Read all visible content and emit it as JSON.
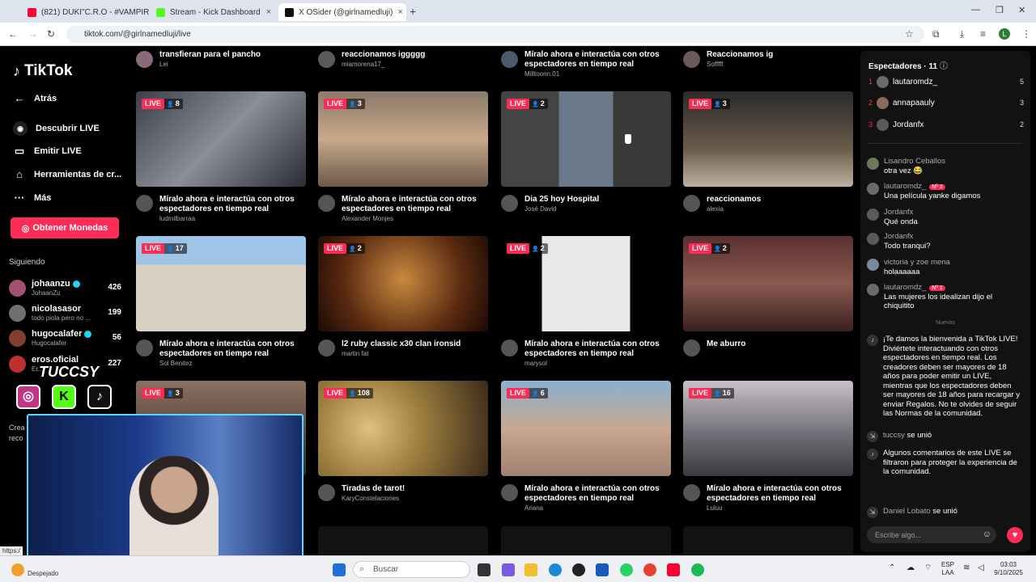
{
  "browser": {
    "tabs": [
      {
        "label": "(821) DUKI\"C.R.O - #VAMPIRO",
        "color": "#ff0033"
      },
      {
        "label": "Stream - Kick Dashboard",
        "color": "#53fc18"
      },
      {
        "label": "X OSider (@girlnamedluji)",
        "color": "#111111"
      }
    ],
    "url": "tiktok.com/@girlnamedluji/live"
  },
  "sidebar": {
    "logo": "TikTok",
    "back": "Atrás",
    "items": [
      {
        "label": "Descubrir LIVE",
        "icon": "discover-icon"
      },
      {
        "label": "Emitir LIVE",
        "icon": "camera-icon"
      },
      {
        "label": "Herramientas de cr...",
        "icon": "home-icon"
      },
      {
        "label": "Más",
        "icon": "more-icon"
      }
    ],
    "coins_button": "Obtener Monedas",
    "following_header": "Siguiendo",
    "following": [
      {
        "name": "johaanzu",
        "sub": "JohaanZu",
        "count": "426",
        "verified": true,
        "color": "#a05070"
      },
      {
        "name": "nicolasasor",
        "sub": "todo piola pero no ...",
        "count": "199",
        "verified": false,
        "color": "#707070"
      },
      {
        "name": "hugocalafer",
        "sub": "Hugocalafer",
        "count": "56",
        "verified": true,
        "color": "#804030"
      },
      {
        "name": "eros.oficial",
        "sub": "Er...",
        "count": "227",
        "verified": false,
        "color": "#c03030"
      }
    ],
    "partial_text": "Crea reco"
  },
  "top_row": [
    {
      "title": "transfieran para el pancho",
      "user": "Lei"
    },
    {
      "title": "reaccionamos iggggg",
      "user": "miamorena17_"
    },
    {
      "title": "Míralo ahora e interactúa con otros espectadores en tiempo real",
      "user": "Milltoonn.01"
    },
    {
      "title": "Reaccionamos ig",
      "user": "Sofffff"
    }
  ],
  "cards": [
    {
      "viewers": "8",
      "title": "Míralo ahora e interactúa con otros espectadores en tiempo real",
      "user": "ludmilbarraa",
      "bg": "linear-gradient(135deg,#3a3f4a,#8a8e96 50%,#2a2d33)"
    },
    {
      "viewers": "3",
      "title": "Míralo ahora e interactúa con otros espectadores en tiempo real",
      "user": "Alexander Monjes",
      "bg": "linear-gradient(180deg,#8a7a6a,#c9a88a 50%,#6a5a4a)"
    },
    {
      "viewers": "2",
      "title": "Dia 25 hoy Hospital",
      "user": "José David",
      "bg": "linear-gradient(90deg,#444 0 34%,#6a7a8a 34% 66%,#3a3a3a 66%)"
    },
    {
      "viewers": "3",
      "title": "reaccionamos",
      "user": "alexia",
      "bg": "linear-gradient(180deg,#2a2a2a,#6a5a4a 60%,#c0b0a0)"
    },
    {
      "viewers": "17",
      "title": "Míralo ahora e interactúa con otros espectadores en tiempo real",
      "user": "Sol Benitez",
      "bg": "linear-gradient(180deg,#9ec4e8 0 30%,#d8d0c0 30%)"
    },
    {
      "viewers": "2",
      "title": "l2 ruby classic x30 clan ironsid",
      "user": "martin fat",
      "bg": "radial-gradient(circle at 50% 45%,#c88a40,#5a2a10 60%,#1a0a05)"
    },
    {
      "viewers": "2",
      "title": "Míralo ahora e interactúa con otros espectadores en tiempo real",
      "user": "marysol",
      "bg": "linear-gradient(90deg,#000 0 24%,#e8e8e8 24% 76%,#000 76%)"
    },
    {
      "viewers": "2",
      "title": "Me aburro",
      "user": "",
      "bg": "linear-gradient(180deg,#5a3030,#8a5a50 50%,#3a2020)"
    },
    {
      "viewers": "3",
      "title": "",
      "user": "",
      "bg": "linear-gradient(180deg,#8a7060,#3a2a22)"
    },
    {
      "viewers": "108",
      "title": "Tiradas de tarot!",
      "user": "KaryConstelaciones",
      "bg": "radial-gradient(circle at 30% 50%,#e0c080,#a08040 40%,#3a2a1a)"
    },
    {
      "viewers": "6",
      "title": "Míralo ahora e interactúa con otros espectadores en tiempo real",
      "user": "Ariana",
      "bg": "linear-gradient(180deg,#8ab0d0,#c8a890 50%,#a08070)"
    },
    {
      "viewers": "16",
      "title": "Míralo ahora e interactúa con otros espectadores en tiempo real",
      "user": "Luluu",
      "bg": "linear-gradient(180deg,#c8c0c8,#6a6a72 60%,#3a3a40)"
    }
  ],
  "live_label": "LIVE",
  "right_panel": {
    "title": "Espectadores · 11",
    "viewers": [
      {
        "rank": "1",
        "name": "lautaromdz_",
        "score": "5",
        "color": "#6a6a6a"
      },
      {
        "rank": "2",
        "name": "annapaauly",
        "score": "3",
        "color": "#8a6a5a"
      },
      {
        "rank": "3",
        "name": "Jordanfx",
        "score": "2",
        "color": "#5a5a5a"
      }
    ],
    "chat": [
      {
        "user": "Lisandro Ceballos",
        "msg": "otra vez 😂",
        "badge": ""
      },
      {
        "user": "lautaromdz_",
        "msg": "Una película yanke digamos",
        "badge": "Nº 2"
      },
      {
        "user": "Jordanfx",
        "msg": "Qué onda",
        "badge": ""
      },
      {
        "user": "Jordanfx",
        "msg": "Todo tranqui?",
        "badge": ""
      },
      {
        "user": "victoria y zoe mena",
        "msg": "holaaaaaa",
        "badge": ""
      },
      {
        "user": "lautaromdz_",
        "msg": "Las mujeres los idealizan dijo el chiquitito",
        "badge": "Nº 1"
      }
    ],
    "new_divider": "Nuevos",
    "system_welcome": "¡Te damos la bienvenida a TikTok LIVE! Diviértete interactuando con otros espectadores en tiempo real. Los creadores deben ser mayores de 18 años para poder emitir un LIVE, mientras que los espectadores deben ser mayores de 18 años para recargar y enviar Regalos. No te olvides de seguir las Normas de la comunidad.",
    "joined_1_user": "tuccsy",
    "joined_label": "se unió",
    "filter_notice": "Algunos comentarios de este LIVE se filtraron para proteger la experiencia de la comunidad.",
    "joined_2_user": "Daniel Lobato",
    "input_placeholder": "Escribe algo..."
  },
  "overlay": {
    "streamer_name": "TUCCSY"
  },
  "taskbar": {
    "search": "Buscar",
    "lang": "ESP\nLAA",
    "time": "03:03",
    "date": "9/10/2025",
    "weather": "Despejado",
    "status_url": "https:/"
  }
}
